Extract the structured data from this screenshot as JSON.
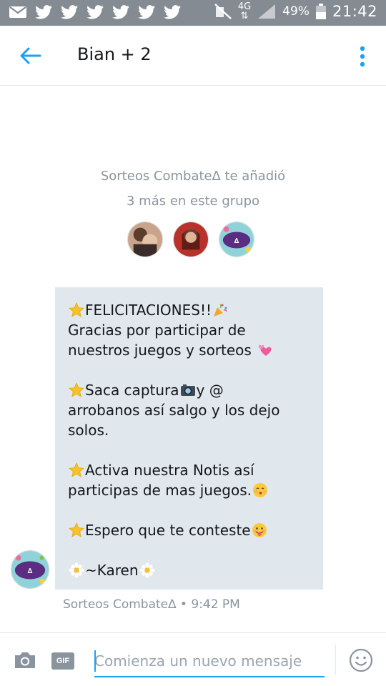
{
  "status_bar": {
    "network": "4G",
    "battery": "49%",
    "time": "21:42"
  },
  "header": {
    "title": "Bian + 2"
  },
  "system_message": {
    "line1": "Sorteos Combate∆ te añadió",
    "line2": "3 más en este grupo"
  },
  "message": {
    "lines": [
      "FELICITACIONES!!",
      "Gracias por participar de",
      "nuestros juegos y sorteos",
      "",
      "Saca captura",
      " y @",
      "arrobanos así salgo y los dejo",
      "solos.",
      "",
      "Activa nuestra Notis así",
      "participas de mas juegos.",
      "",
      "Espero que te conteste",
      "",
      "~Karen"
    ],
    "meta": "Sorteos Combate∆ • 9:42 PM"
  },
  "composer": {
    "gif_label": "GIF",
    "placeholder": "Comienza un nuevo mensaje"
  },
  "colors": {
    "accent": "#1da1f2",
    "bubble": "#e1e8ed",
    "muted": "#8a949e",
    "status_bar": "#858b93"
  }
}
